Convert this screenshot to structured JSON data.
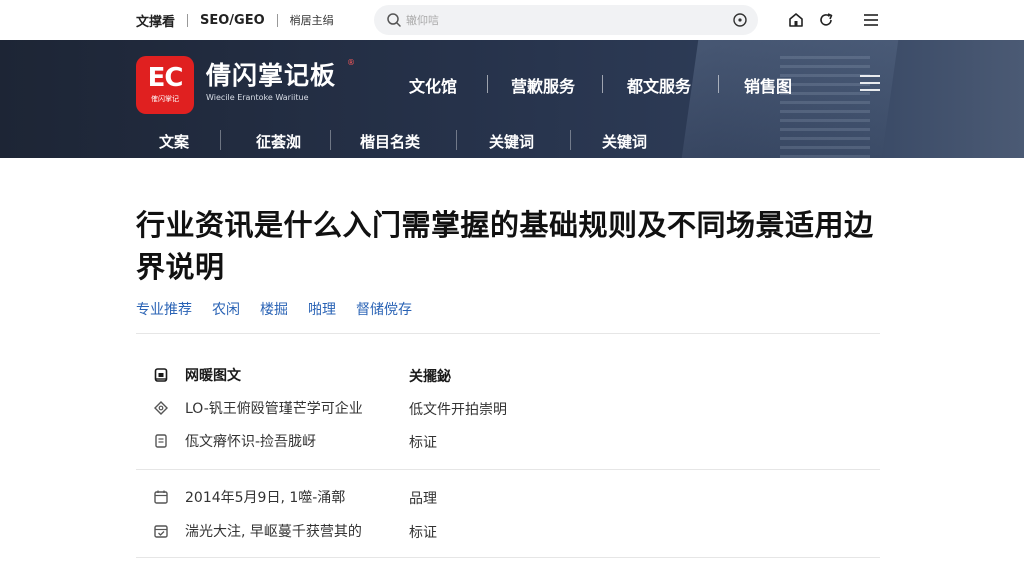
{
  "topbar": {
    "links": [
      "文撑看",
      "SEO/GEO",
      "梢居主绢"
    ],
    "search_placeholder": "辙仰唁",
    "colors": {
      "bg": "#ffffff",
      "search_bg": "#f1f2f4"
    }
  },
  "brand": {
    "logo_text": "EC",
    "logo_sub": "傕闪掌记",
    "name": "倩闪掌记板",
    "en_name": "Wiecile Erantoke Wariitue",
    "reg_mark": "®",
    "color": "#e02020"
  },
  "main_nav": [
    "文化馆",
    "营歉服务",
    "都文服务",
    "销售图"
  ],
  "sub_nav": [
    "文案",
    "征荟洳",
    "楷目名类",
    "关键词",
    "关键词"
  ],
  "article": {
    "title": "行业资讯是什么入门需掌握的基础规则及不同场景适用边界说明",
    "tags": [
      "专业推荐",
      "农闲",
      "楼掘",
      "啪理",
      "督储傥存"
    ],
    "rows_group1": [
      {
        "icon": "lock-icon",
        "label": "网暖图文",
        "value": "关擺鉍",
        "bold": true
      },
      {
        "icon": "diamond-icon",
        "label": "LO-钒王俯殴管瑾芒学可企业",
        "value": "低文件开拍崇明",
        "bold": false
      },
      {
        "icon": "document-icon",
        "label": "佤文瘠怀识-捡吾胧岈",
        "value": "标证",
        "bold": false
      }
    ],
    "rows_group2": [
      {
        "icon": "calendar-icon",
        "label": "2014年5月9日, 1噬-涌鄣",
        "value": "品理",
        "bold": false
      },
      {
        "icon": "calendar-check-icon",
        "label": "湍光大注, 早岖蔓千获营其的",
        "value": "标证",
        "bold": false
      }
    ],
    "colors": {
      "tag": "#2a63b5",
      "title": "#111111"
    }
  }
}
